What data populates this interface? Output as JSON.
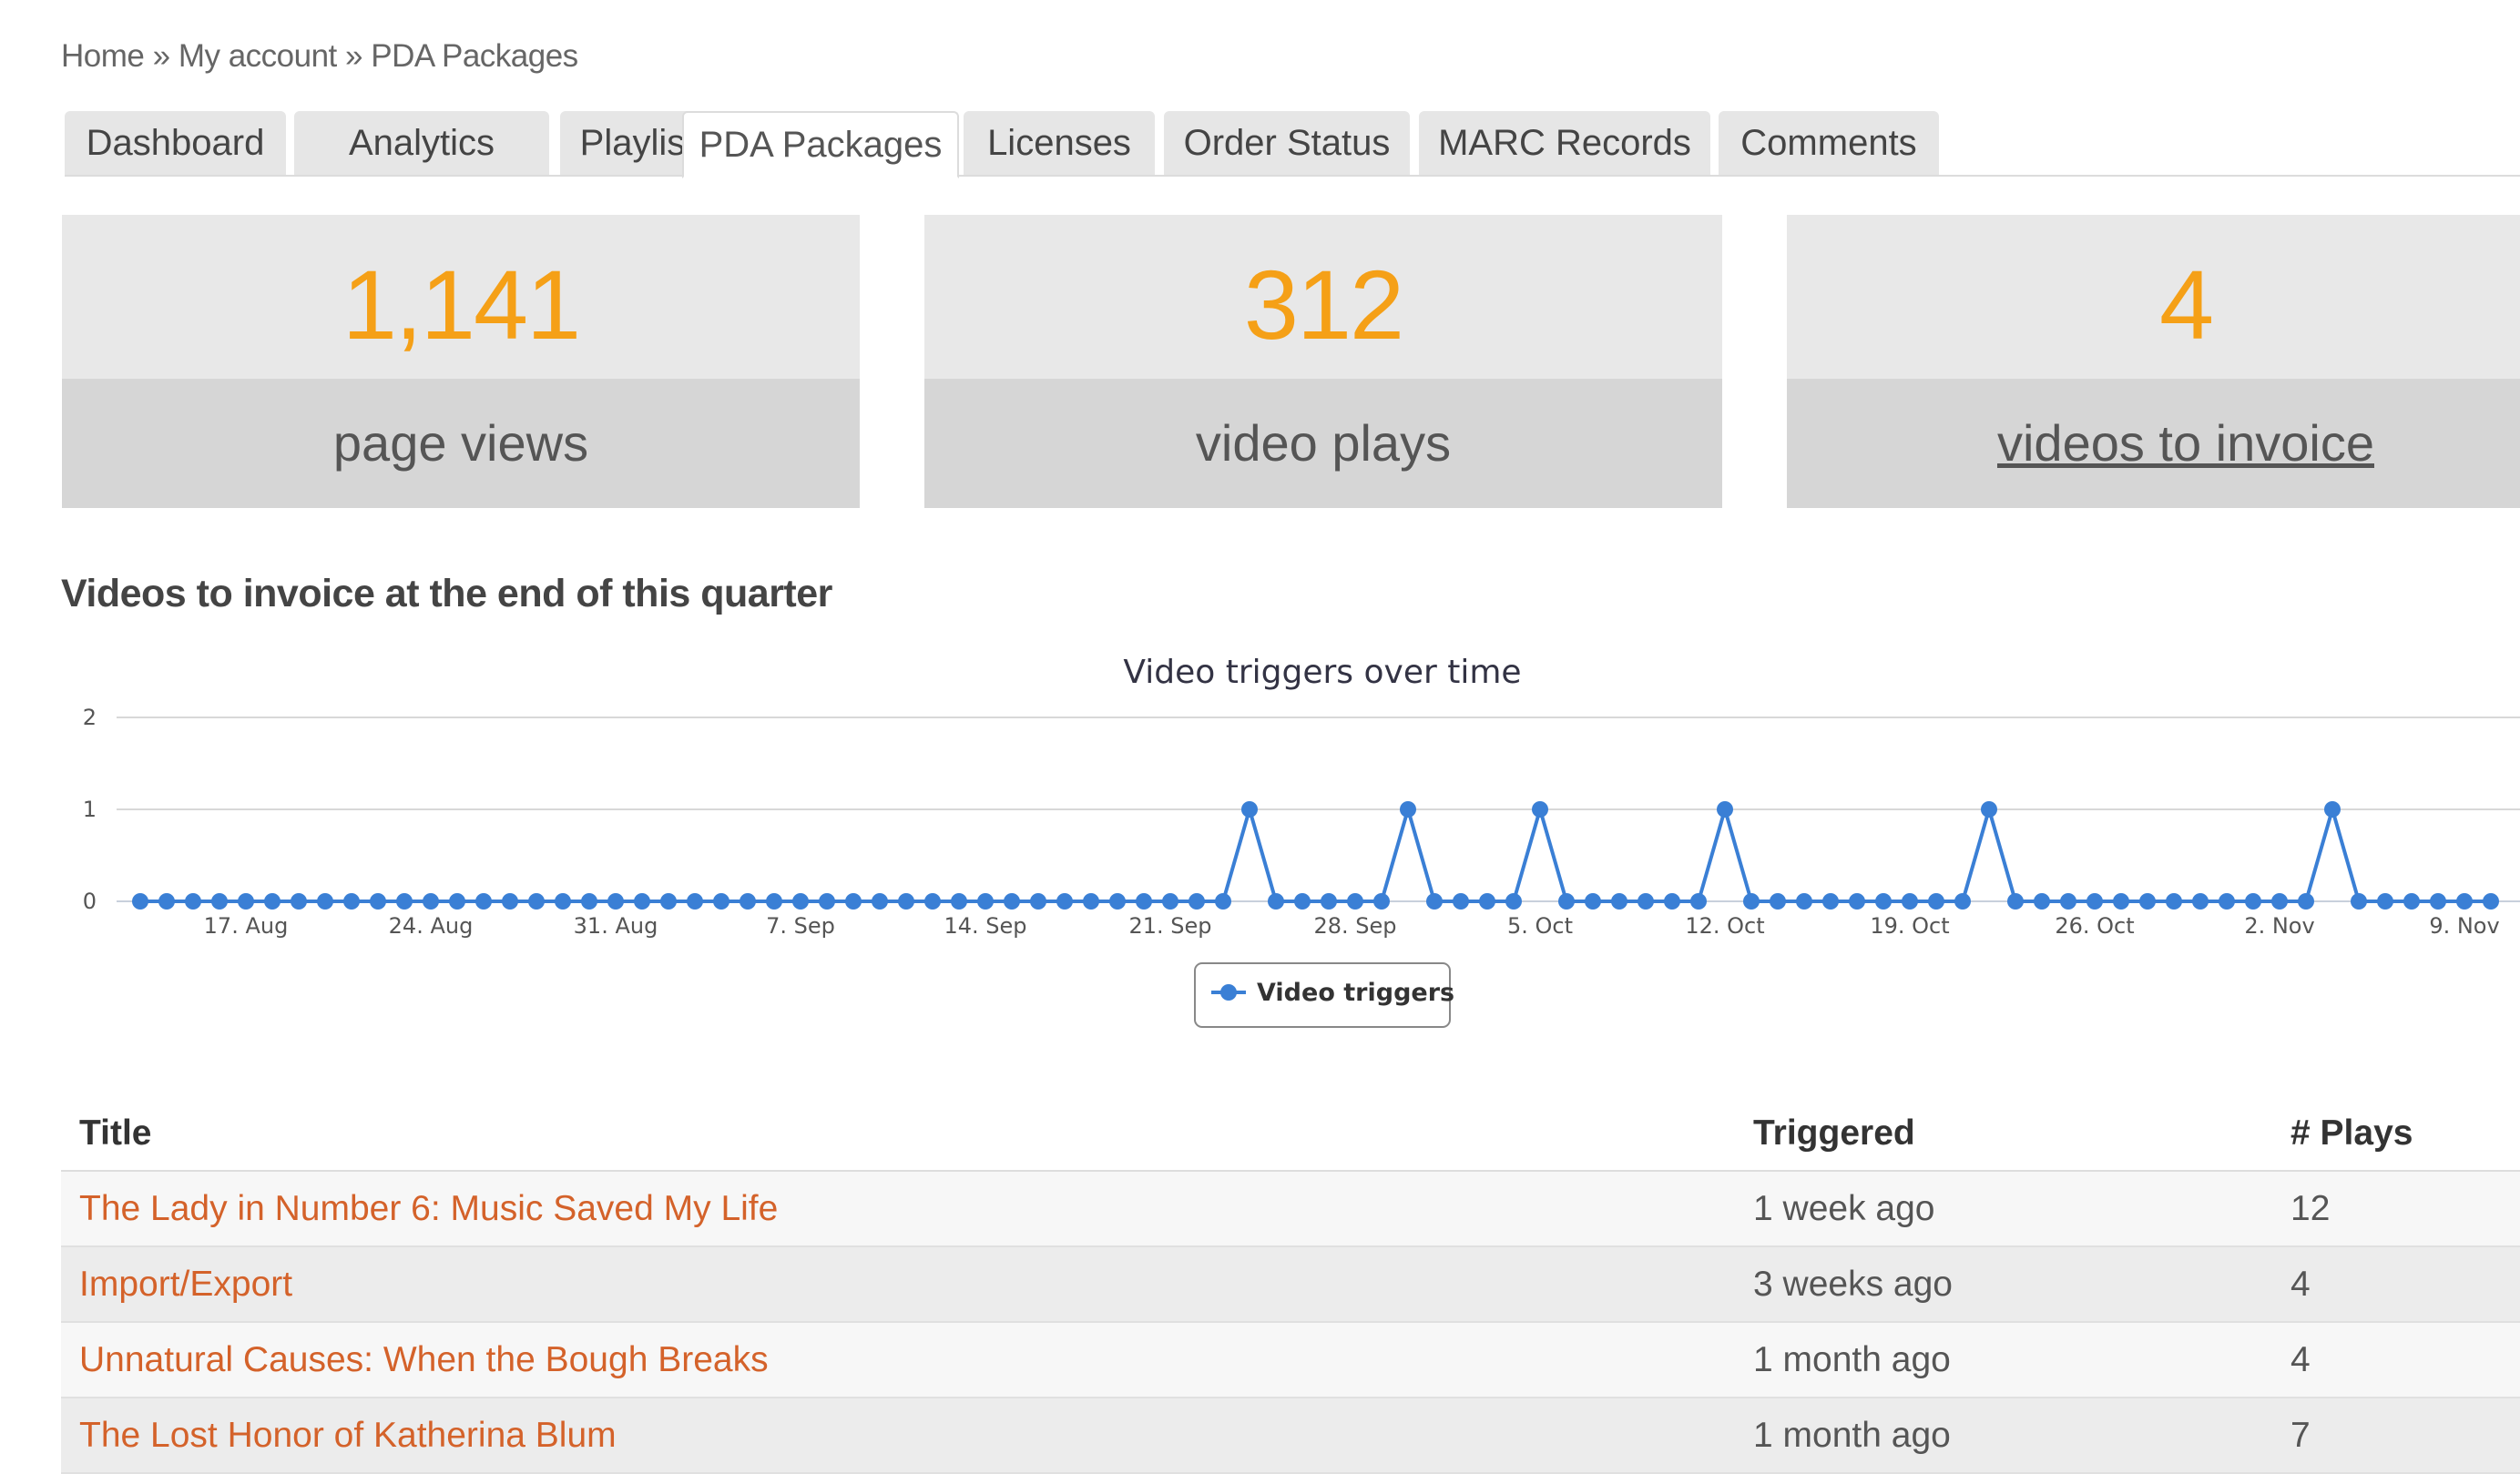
{
  "breadcrumb": {
    "items": [
      "Home",
      "My account",
      "PDA Packages"
    ],
    "separator": "»"
  },
  "tabs": [
    {
      "label": "Dashboard",
      "active": false
    },
    {
      "label": "Analytics",
      "active": false
    },
    {
      "label": "Playlists",
      "active": false
    },
    {
      "label": "PDA Packages",
      "active": true
    },
    {
      "label": "Licenses",
      "active": false
    },
    {
      "label": "Order Status",
      "active": false
    },
    {
      "label": "MARC Records",
      "active": false
    },
    {
      "label": "Comments",
      "active": false
    }
  ],
  "stats": [
    {
      "value": "1,141",
      "label": "page views"
    },
    {
      "value": "312",
      "label": "video plays"
    },
    {
      "value": "4",
      "label": "videos to invoice"
    }
  ],
  "section": {
    "title": "Videos to invoice at the end of this quarter"
  },
  "colors": {
    "accent": "#f5a017",
    "link": "#d4622a",
    "series": "#3a7fd5"
  },
  "chart_data": {
    "type": "line",
    "title": "Video triggers over time",
    "xlabel": "",
    "ylabel": "",
    "ylim": [
      0,
      2
    ],
    "yticks": [
      "0",
      "1",
      "2"
    ],
    "xticks": [
      {
        "label": "17. Aug",
        "day": 4
      },
      {
        "label": "24. Aug",
        "day": 11
      },
      {
        "label": "31. Aug",
        "day": 18
      },
      {
        "label": "7. Sep",
        "day": 25
      },
      {
        "label": "14. Sep",
        "day": 32
      },
      {
        "label": "21. Sep",
        "day": 39
      },
      {
        "label": "28. Sep",
        "day": 46
      },
      {
        "label": "5. Oct",
        "day": 53
      },
      {
        "label": "12. Oct",
        "day": 60
      },
      {
        "label": "19. Oct",
        "day": 67
      },
      {
        "label": "26. Oct",
        "day": 74
      },
      {
        "label": "2. Nov",
        "day": 81
      },
      {
        "label": "9. Nov",
        "day": 88
      }
    ],
    "grid": true,
    "legend_position": "bottom-center",
    "series": [
      {
        "name": "Video triggers",
        "values": [
          0,
          0,
          0,
          0,
          0,
          0,
          0,
          0,
          0,
          0,
          0,
          0,
          0,
          0,
          0,
          0,
          0,
          0,
          0,
          0,
          0,
          0,
          0,
          0,
          0,
          0,
          0,
          0,
          0,
          0,
          0,
          0,
          0,
          0,
          0,
          0,
          0,
          0,
          0,
          0,
          0,
          0,
          1,
          0,
          0,
          0,
          0,
          0,
          1,
          0,
          0,
          0,
          0,
          1,
          0,
          0,
          0,
          0,
          0,
          0,
          1,
          0,
          0,
          0,
          0,
          0,
          0,
          0,
          0,
          0,
          1,
          0,
          0,
          0,
          0,
          0,
          0,
          0,
          0,
          0,
          0,
          0,
          0,
          1,
          0,
          0,
          0,
          0,
          0,
          0
        ]
      }
    ]
  },
  "table": {
    "headers": [
      "Title",
      "Triggered",
      "# Plays"
    ],
    "rows": [
      {
        "title": "The Lady in Number 6: Music Saved My Life",
        "triggered": "1 week ago",
        "plays": "12"
      },
      {
        "title": "Import/Export",
        "triggered": "3 weeks ago",
        "plays": "4"
      },
      {
        "title": "Unnatural Causes: When the Bough Breaks",
        "triggered": "1 month ago",
        "plays": "4"
      },
      {
        "title": "The Lost Honor of Katherina Blum",
        "triggered": "1 month ago",
        "plays": "7"
      }
    ]
  }
}
